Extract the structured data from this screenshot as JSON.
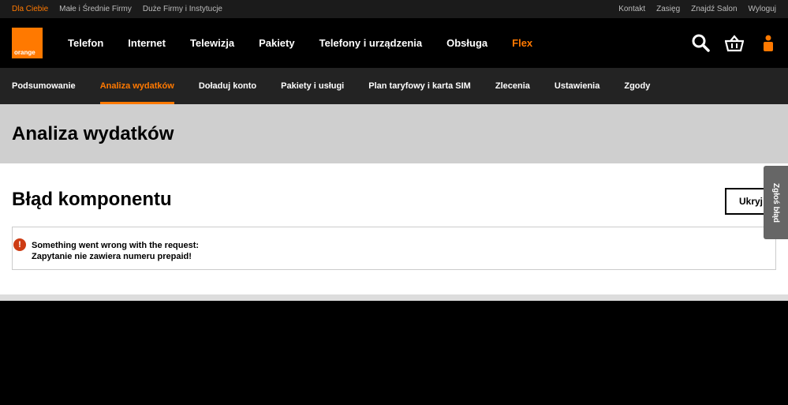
{
  "topbar": {
    "left": [
      {
        "label": "Dla Ciebie",
        "active": true
      },
      {
        "label": "Małe i Średnie Firmy",
        "active": false
      },
      {
        "label": "Duże Firmy i Instytucje",
        "active": false
      }
    ],
    "right": [
      "Kontakt",
      "Zasięg",
      "Znajdź Salon",
      "Wyloguj"
    ]
  },
  "logo": {
    "text": "orange",
    "color": "#ff7900"
  },
  "mainnav": {
    "items": [
      "Telefon",
      "Internet",
      "Telewizja",
      "Pakiety",
      "Telefony i urządzenia",
      "Obsługa",
      "Flex"
    ],
    "icons": [
      "search-icon",
      "basket-icon",
      "user-icon"
    ]
  },
  "subnav": {
    "items": [
      "Podsumowanie",
      "Analiza wydatków",
      "Doładuj konto",
      "Pakiety i usługi",
      "Plan taryfowy i karta SIM",
      "Zlecenia",
      "Ustawienia",
      "Zgody"
    ],
    "active_index": 1
  },
  "page": {
    "title": "Analiza wydatków"
  },
  "component": {
    "heading": "Błąd komponentu",
    "hide_button": "Ukryj",
    "error_icon": "!",
    "error_line1": "Something went wrong with the request:",
    "error_line2": "Zapytanie nie zawiera numeru prepaid!"
  },
  "feedback": {
    "label": "Zgłoś błąd"
  },
  "colors": {
    "accent": "#ff7900",
    "error": "#cd3c14"
  }
}
